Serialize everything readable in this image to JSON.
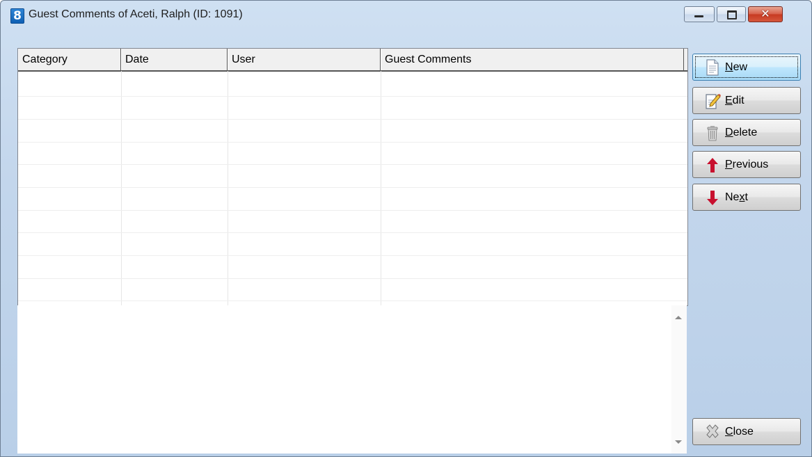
{
  "window": {
    "app_icon_glyph": "8",
    "title": "Guest Comments of Aceti, Ralph (ID: 1091)",
    "controls": {
      "minimize": "minimize-icon",
      "maximize": "maximize-icon",
      "close": "close-x-icon"
    }
  },
  "grid": {
    "columns": [
      "Category",
      "Date",
      "User",
      "Guest Comments"
    ],
    "rows": []
  },
  "memo": {
    "text": ""
  },
  "buttons": {
    "new": {
      "pre": "",
      "acc": "N",
      "post": "ew",
      "icon": "document-icon"
    },
    "edit": {
      "pre": "",
      "acc": "E",
      "post": "dit",
      "icon": "edit-document-icon"
    },
    "delete": {
      "pre": "",
      "acc": "D",
      "post": "elete",
      "icon": "trash-icon"
    },
    "previous": {
      "pre": "",
      "acc": "P",
      "post": "revious",
      "icon": "arrow-up-icon"
    },
    "next": {
      "pre": "Ne",
      "acc": "x",
      "post": "t",
      "icon": "arrow-down-icon"
    },
    "close": {
      "pre": "",
      "acc": "C",
      "post": "lose",
      "icon": "close-icon"
    }
  },
  "colors": {
    "arrow_red": "#c8102e",
    "title_bg": "#c3d6ec",
    "focus_border": "#3c7fb1"
  }
}
